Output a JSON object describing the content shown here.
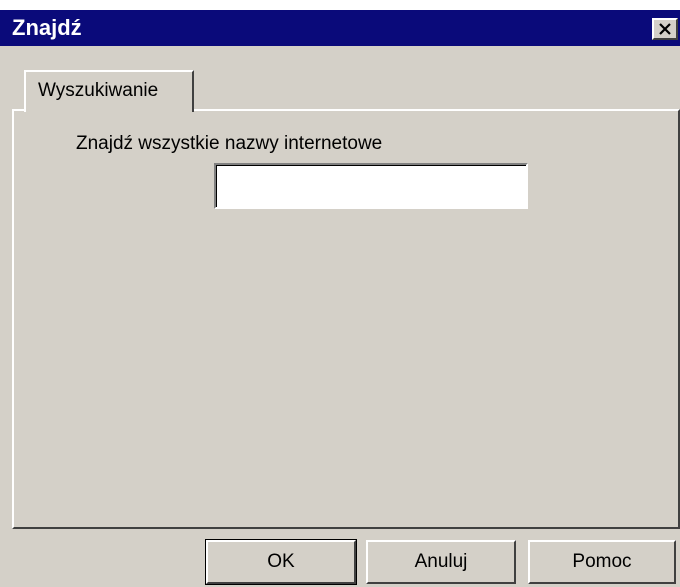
{
  "window": {
    "title": "Znajdź"
  },
  "tabs": [
    {
      "label": "Wyszukiwanie",
      "selected": true
    }
  ],
  "search": {
    "label": "Znajdź wszystkie nazwy internetowe",
    "value": "",
    "placeholder": ""
  },
  "buttons": {
    "ok": "OK",
    "cancel": "Anuluj",
    "help": "Pomoc"
  },
  "icons": {
    "close": "close-icon"
  },
  "colors": {
    "titlebar": "#0a0a7a",
    "face": "#d4d0c8",
    "title_text": "#ffffff"
  }
}
